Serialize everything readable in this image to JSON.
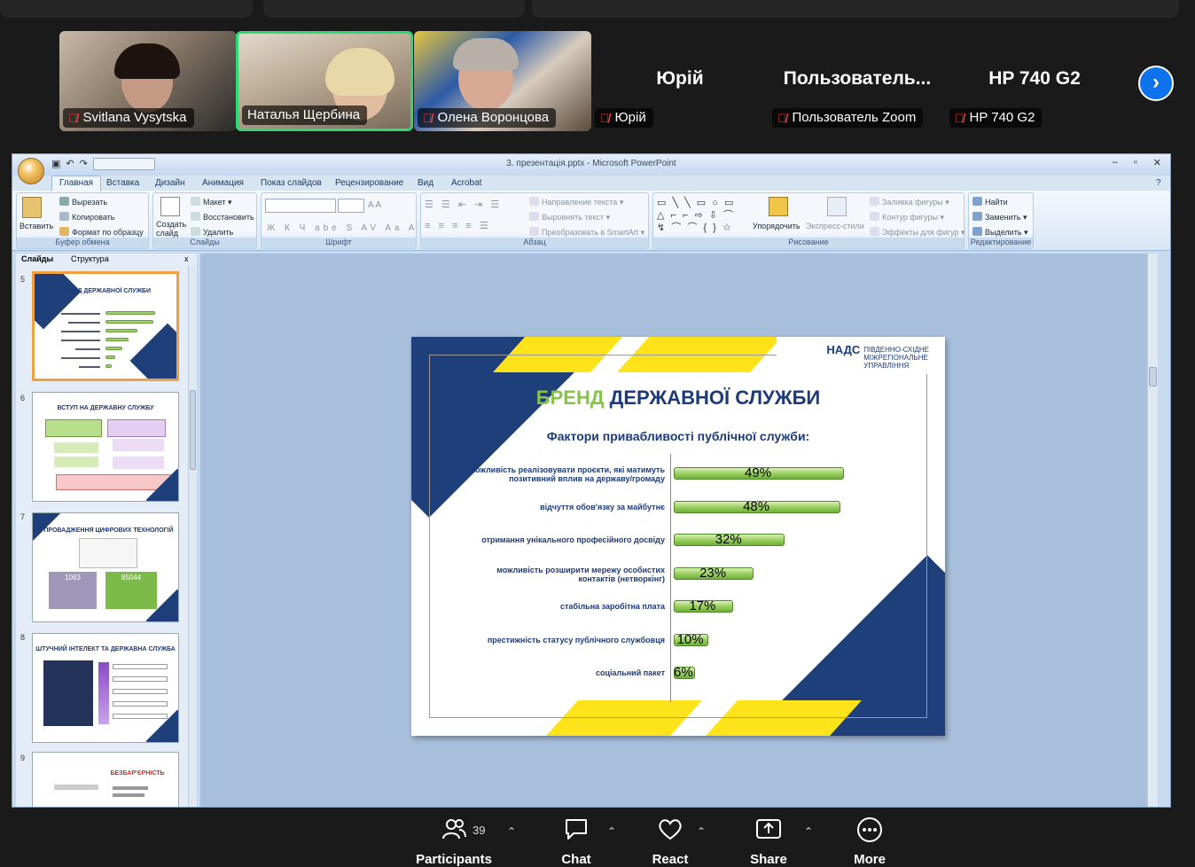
{
  "gallery": {
    "participants": [
      {
        "name": "Svitlana Vysytska",
        "muted": true
      },
      {
        "name": "Наталья Щербина",
        "muted": false
      },
      {
        "name": "Олена Воронцова",
        "muted": true
      },
      {
        "name": "Юрій",
        "big": "Юрій",
        "muted": true
      },
      {
        "name": "Пользователь Zoom",
        "big": "Пользователь...",
        "muted": true
      },
      {
        "name": "HP 740 G2",
        "big": "HP 740 G2",
        "muted": true
      }
    ]
  },
  "ppt": {
    "window_title": "3. презентація.pptx - Microsoft PowerPoint",
    "tabs": [
      "Главная",
      "Вставка",
      "Дизайн",
      "Анимация",
      "Показ слайдов",
      "Рецензирование",
      "Вид",
      "Acrobat"
    ],
    "ribbon": {
      "paste": "Вставить",
      "cut": "Вырезать",
      "copy": "Копировать",
      "format_painter": "Формат по образцу",
      "clipboard_group": "Буфер обмена",
      "new_slide": "Создать слайд",
      "layout": "Макет",
      "reset": "Восстановить",
      "delete": "Удалить",
      "slides_group": "Слайды",
      "font_group": "Шрифт",
      "text_direction": "Направление текста",
      "align_text": "Выровнять текст",
      "smartart": "Преобразовать в SmartArt",
      "paragraph_group": "Абзац",
      "arrange": "Упорядочить",
      "quick_styles": "Экспресс-стили",
      "shape_fill": "Заливка фигуры",
      "shape_outline": "Контур фигуры",
      "shape_effects": "Эффекты для фигур",
      "drawing_group": "Рисование",
      "find": "Найти",
      "replace": "Заменить",
      "select": "Выделить",
      "editing_group": "Редактирование"
    },
    "pane_tabs": {
      "slides": "Слайды",
      "outline": "Структура",
      "close": "x"
    },
    "thumbnails": [
      {
        "num": "5",
        "title": "БРЕНД ДЕРЖАВНОЇ СЛУЖБИ"
      },
      {
        "num": "6",
        "title": "ВСТУП НА ДЕРЖАВНУ СЛУЖБУ"
      },
      {
        "num": "7",
        "title": "В ПРОВАДЖЕННЯ ЦИФРОВИХ ТЕХНОЛОГІЙ",
        "v1": "1063",
        "v2": "85044"
      },
      {
        "num": "8",
        "title": "ШТУЧНИЙ ІНТЕЛЕКТ ТА ДЕРЖАВНА СЛУЖБА"
      },
      {
        "num": "9",
        "title": "БЕЗБАР'ЄРНІСТЬ"
      }
    ],
    "slide": {
      "title_green": "БРЕНД",
      "title_blue": "ДЕРЖАВНОЇ СЛУЖБИ",
      "logo_name": "НАДС",
      "logo_line1": "ПІВДЕННО-СХІДНЕ",
      "logo_line2": "МІЖРЕГІОНАЛЬНЕ",
      "logo_line3": "УПРАВЛІННЯ",
      "subtitle": "Фактори привабливості публічної служби:"
    }
  },
  "chart_data": {
    "type": "bar",
    "orientation": "horizontal",
    "title": "Фактори привабливості публічної служби:",
    "categories": [
      "можливість реалізовувати проєкти, які матимуть позитивний вплив на державу/громаду",
      "відчуття обов'язку за майбутнє",
      "отримання унікального професійного досвіду",
      "можливість розширити мережу особистих контактів (нетворкінг)",
      "стабільна заробітна плата",
      "престижність статусу публічного службовця",
      "соціальний пакет"
    ],
    "values": [
      49,
      48,
      32,
      23,
      17,
      10,
      6
    ],
    "labels": [
      "49%",
      "48%",
      "32%",
      "23%",
      "17%",
      "10%",
      "6%"
    ],
    "xlim": [
      0,
      50
    ],
    "grid": false,
    "color": "#9bd060"
  },
  "toolbar": {
    "participants_label": "Participants",
    "participants_count": "39",
    "chat_label": "Chat",
    "react_label": "React",
    "share_label": "Share",
    "more_label": "More"
  }
}
